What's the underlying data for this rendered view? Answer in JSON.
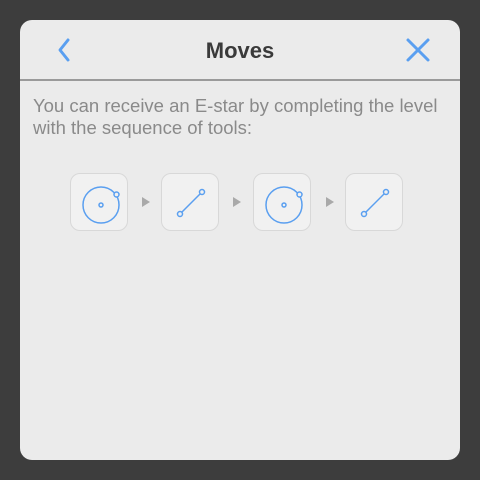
{
  "dialog": {
    "title": "Moves",
    "back_icon": "chevron-left-icon",
    "close_icon": "close-icon",
    "accent_color": "#5a9ff0"
  },
  "description": "You can receive an E-star by completing the level with the sequence of tools:",
  "tool_sequence": [
    {
      "tool": "circle-tool-icon"
    },
    {
      "tool": "line-tool-icon"
    },
    {
      "tool": "circle-tool-icon"
    },
    {
      "tool": "line-tool-icon"
    }
  ]
}
